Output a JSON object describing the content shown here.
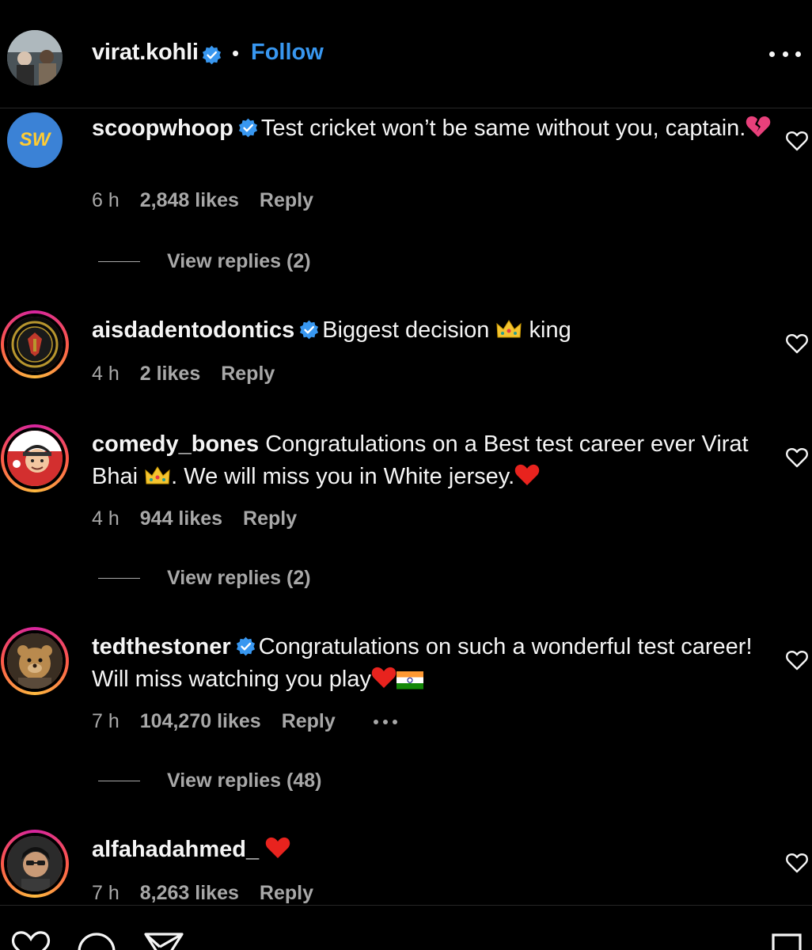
{
  "header": {
    "username": "virat.kohli",
    "separator": "•",
    "follow_label": "Follow",
    "more_icon": "more-horizontal-icon"
  },
  "comments": [
    {
      "username": "scoopwhoop",
      "verified": true,
      "avatar_text": "SW",
      "text": "Test cricket won’t be same without you, captain.",
      "emoji": "broken-heart",
      "time": "6 h",
      "likes": "2,848 likes",
      "reply_label": "Reply",
      "view_replies": "View replies (2)"
    },
    {
      "username": "aisdadentodontics",
      "verified": true,
      "text_before": "Biggest decision",
      "emoji": "crown",
      "text_after": "king",
      "time": "4 h",
      "likes": "2 likes",
      "reply_label": "Reply"
    },
    {
      "username": "comedy_bones",
      "verified": false,
      "text_before": "Congratulations on a Best test career ever Virat Bhai",
      "emoji": "crown",
      "text_after": ". We will miss you in White jersey.",
      "emoji2": "red-heart",
      "time": "4 h",
      "likes": "944 likes",
      "reply_label": "Reply",
      "view_replies": "View replies (2)"
    },
    {
      "username": "tedthestoner",
      "verified": true,
      "text": "Congratulations on such a wonderful test career! Will miss watching you play",
      "emoji": "red-heart",
      "emoji2": "india-flag",
      "time": "7 h",
      "likes": "104,270 likes",
      "reply_label": "Reply",
      "view_replies": "View replies (48)"
    },
    {
      "username": "alfahadahmed_",
      "verified": false,
      "emoji": "red-heart",
      "time": "7 h",
      "likes": "8,263 likes",
      "reply_label": "Reply"
    }
  ],
  "colors": {
    "background": "#000000",
    "text": "#f5f5f5",
    "secondary": "#a8a8a8",
    "follow": "#3897f0",
    "verified": "#3897f0",
    "heart": "#ff3040"
  }
}
